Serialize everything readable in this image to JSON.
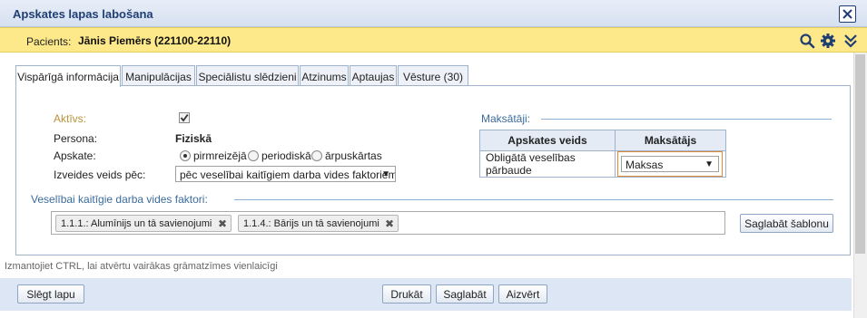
{
  "window": {
    "title": "Apskates lapas labošana"
  },
  "patient": {
    "label": "Pacients:",
    "name": "Jānis Piemērs (221100-22110)"
  },
  "icons": {
    "search": "search-icon",
    "settings": "gear-icon",
    "expand": "double-chevron-down-icon",
    "close": "close-icon"
  },
  "tabs": [
    {
      "label": "Vispārīgā informācija",
      "active": true
    },
    {
      "label": "Manipulācijas",
      "active": false
    },
    {
      "label": "Speciālistu slēdzieni",
      "active": false
    },
    {
      "label": "Atzinums",
      "active": false
    },
    {
      "label": "Aptaujas",
      "active": false
    },
    {
      "label": "Vēsture (30)",
      "active": false
    }
  ],
  "general": {
    "active_label": "Aktīvs:",
    "active_checked": true,
    "person_label": "Persona:",
    "person_value": "Fiziskā",
    "exam_label": "Apskate:",
    "exam_options": [
      "pirmreizējā",
      "periodiskā",
      "ārpuskārtas"
    ],
    "exam_selected": "pirmreizējā",
    "created_by_label": "Izveides veids pēc:",
    "created_by_value": "pēc veselībai kaitīgiem darba vides faktoriem"
  },
  "payers": {
    "legend": "Maksātāji:",
    "columns": [
      "Apskates veids",
      "Maksātājs"
    ],
    "rows": [
      {
        "type": "Obligātā veselības pārbaude",
        "payer": "Maksas"
      }
    ]
  },
  "factors": {
    "legend": "Veselībai kaitīgie darba vides faktori:",
    "chips": [
      "1.1.1.: Alumīnijs un tā savienojumi",
      "1.1.4.: Bārijs un tā savienojumi"
    ],
    "save_template_label": "Saglabāt šablonu"
  },
  "hint": "Izmantojiet CTRL, lai atvērtu vairākas grāmatzīmes vienlaicīgi",
  "footer": {
    "close_page_label": "Slēgt lapu",
    "print_label": "Drukāt",
    "save_label": "Saglabāt",
    "close_label": "Aizvērt"
  },
  "colors": {
    "accent": "#1f3f73",
    "patient_bar": "#fde98a",
    "highlight_border": "#e08a3c"
  }
}
